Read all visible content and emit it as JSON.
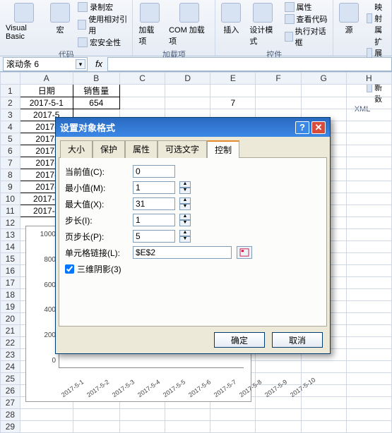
{
  "ribbon": {
    "groups": {
      "code": {
        "big1": "Visual Basic",
        "big2": "宏",
        "items": [
          "录制宏",
          "使用相对引用",
          "宏安全性"
        ],
        "title": "代码"
      },
      "addins": {
        "big1": "加载项",
        "big2": "COM 加载项",
        "title": "加载项"
      },
      "controls": {
        "big1": "插入",
        "big2": "设计模式",
        "items": [
          "属性",
          "查看代码",
          "执行对话框"
        ],
        "title": "控件"
      },
      "xml": {
        "big1": "源",
        "items": [
          "映射属",
          "扩展包",
          "刷新数"
        ],
        "title": "XML"
      }
    }
  },
  "name_box": "滚动条 6",
  "sheet": {
    "cols": [
      "A",
      "B",
      "C",
      "D",
      "E",
      "F",
      "G",
      "H"
    ],
    "rows": [
      {
        "n": 1,
        "A": "日期",
        "B": "销售量"
      },
      {
        "n": 2,
        "A": "2017-5-1",
        "B": "654",
        "E": "7"
      },
      {
        "n": 3,
        "A": "2017-5"
      },
      {
        "n": 4,
        "A": "2017-"
      },
      {
        "n": 5,
        "A": "2017-"
      },
      {
        "n": 6,
        "A": "2017-"
      },
      {
        "n": 7,
        "A": "2017-"
      },
      {
        "n": 8,
        "A": "2017-"
      },
      {
        "n": 9,
        "A": "2017-"
      },
      {
        "n": 10,
        "A": "2017-5"
      },
      {
        "n": 11,
        "A": "2017-5"
      },
      {
        "n": 12
      },
      {
        "n": 13
      },
      {
        "n": 14
      },
      {
        "n": 15
      },
      {
        "n": 16
      },
      {
        "n": 17
      },
      {
        "n": 18
      },
      {
        "n": 19
      },
      {
        "n": 20
      },
      {
        "n": 21
      },
      {
        "n": 22
      },
      {
        "n": 23
      },
      {
        "n": 24
      },
      {
        "n": 25
      },
      {
        "n": 26
      },
      {
        "n": 27
      },
      {
        "n": 28
      },
      {
        "n": 29
      }
    ]
  },
  "dialog": {
    "title": "设置对象格式",
    "tabs": [
      "大小",
      "保护",
      "属性",
      "可选文字",
      "控制"
    ],
    "active_tab": 4,
    "fields": {
      "current": {
        "label": "当前值(C):",
        "value": "0"
      },
      "min": {
        "label": "最小值(M):",
        "value": "1"
      },
      "max": {
        "label": "最大值(X):",
        "value": "31"
      },
      "step": {
        "label": "步长(I):",
        "value": "1"
      },
      "page": {
        "label": "页步长(P):",
        "value": "5"
      },
      "link": {
        "label": "单元格链接(L):",
        "value": "$E$2"
      }
    },
    "shade": "三维阴影(3)",
    "ok": "确定",
    "cancel": "取消"
  },
  "chart_data": {
    "type": "bar",
    "categories": [
      "2017-5-1",
      "2017-5-2",
      "2017-5-3",
      "2017-5-4",
      "2017-5-5",
      "2017-5-6",
      "2017-5-7",
      "2017-5-8",
      "2017-5-9",
      "2017-5-10"
    ],
    "values": [
      654,
      null,
      null,
      null,
      null,
      null,
      null,
      null,
      null,
      null
    ],
    "y_ticks": [
      1000,
      800,
      600,
      400,
      200,
      0
    ],
    "ylim": [
      0,
      1000
    ],
    "title": "",
    "xlabel": "",
    "ylabel": ""
  }
}
